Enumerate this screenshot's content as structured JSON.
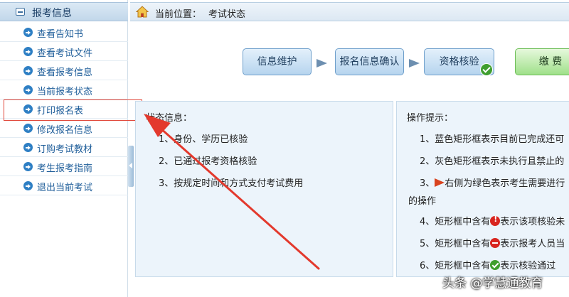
{
  "sidebar": {
    "title": "报考信息",
    "items": [
      {
        "label": "查看告知书"
      },
      {
        "label": "查看考试文件"
      },
      {
        "label": "查看报考信息"
      },
      {
        "label": "当前报考状态"
      },
      {
        "label": "打印报名表"
      },
      {
        "label": "修改报名信息"
      },
      {
        "label": "订购考试教材"
      },
      {
        "label": "考生报考指南"
      },
      {
        "label": "退出当前考试"
      }
    ]
  },
  "breadcrumb": {
    "label": "当前位置：",
    "value": "考试状态"
  },
  "steps": [
    {
      "label": "信息维护",
      "state": "blue"
    },
    {
      "label": "报名信息确认",
      "state": "blue"
    },
    {
      "label": "资格核验",
      "state": "blue",
      "badge": "check-icon"
    },
    {
      "label": "缴 费",
      "state": "green"
    }
  ],
  "status_panel": {
    "title": "状态信息：",
    "lines": [
      "1、身份、学历已核验",
      "2、已通过报考资格核验",
      "3、按规定时间和方式支付考试费用"
    ]
  },
  "tips_panel": {
    "title": "操作提示：",
    "line1": "1、蓝色矩形框表示目前已完成还可",
    "line2": "2、灰色矩形框表示未执行且禁止的",
    "line3_prefix": "3、",
    "line3_suffix": "右侧为绿色表示考生需要进行",
    "line3_cont": "的操作",
    "line4_prefix": "4、矩形框中含有",
    "line4_suffix": "表示该项核验未",
    "line5_prefix": "5、矩形框中含有",
    "line5_suffix": "表示报考人员当",
    "line6_prefix": "6、矩形框中含有",
    "line6_suffix": "表示核验通过"
  },
  "watermark": "头条 @学慧通教育",
  "colors": {
    "accent_blue": "#2e7fc4",
    "highlight_red": "#e0483b",
    "step_green": "#9fe08a"
  }
}
